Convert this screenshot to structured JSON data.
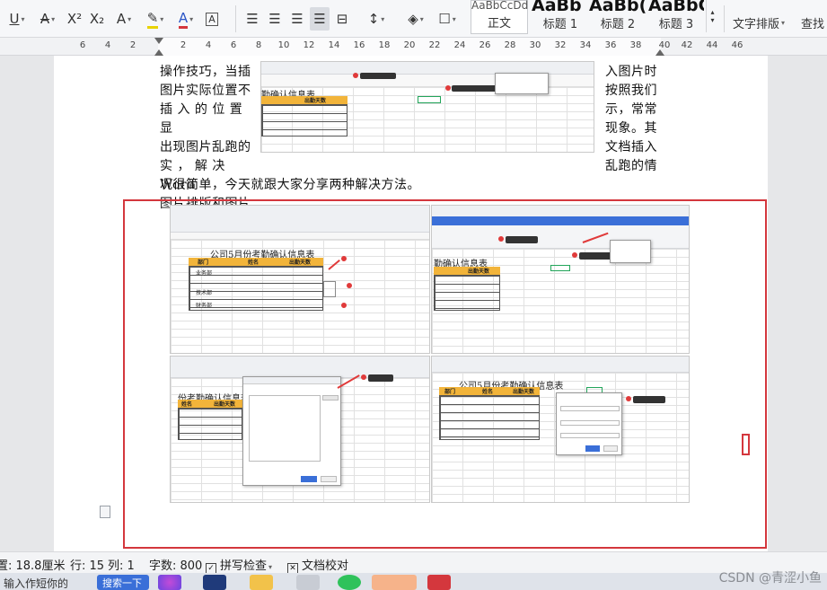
{
  "ribbon": {
    "style_previews": [
      "AaBbCcDd",
      "AaBb",
      "AaBb(",
      "AaBbC("
    ],
    "styles": [
      "正文",
      "标题 1",
      "标题 2",
      "标题 3"
    ],
    "text_layout_label": "文字排版",
    "find_label": "查找"
  },
  "ruler": {
    "ticks": [
      "6",
      "4",
      "2",
      "2",
      "4",
      "6",
      "8",
      "10",
      "12",
      "14",
      "16",
      "18",
      "20",
      "22",
      "24",
      "26",
      "28",
      "30",
      "32",
      "34",
      "36",
      "38",
      "40",
      "42",
      "44",
      "46"
    ]
  },
  "document": {
    "left_lines": [
      "操作技巧，当插",
      "图片实际位置不",
      "插 入 的 位 置 显",
      "出现图片乱跑的",
      "实 ， 解 决  Word",
      "图片排版和图片"
    ],
    "right_lines": [
      "入图片时",
      "按照我们",
      "示，常常",
      "现象。其",
      "文档插入",
      "乱跑的情"
    ],
    "full_line": "况很简单，今天就跟大家分享两种解决方法。",
    "embedded": {
      "table_title_1": "勤确认信息表",
      "table_title_2": "公司5月份考勤确认信息表",
      "table_title_3": "份考勤确认信息表",
      "table_title_4": "勤确认信息表",
      "table_title_5": "公司5月份考勤确认信息表",
      "col_dept": "部门",
      "col_name": "姓名",
      "col_days": "出勤天数",
      "col_days_short": "出勤天数",
      "dept_1": "业务部",
      "dept_2": "技术部",
      "dept_3": "财务部"
    }
  },
  "status_bar": {
    "position": "置: 18.8厘米",
    "line": "行: 15",
    "column": "列: 1",
    "word_count": "字数: 800",
    "spell_check": "拼写检查",
    "doc_check": "文档校对"
  },
  "taskbar": {
    "search_text": "搜索一下",
    "left_text": "输入作短你的"
  },
  "watermark": "CSDN @青涩小鱼"
}
